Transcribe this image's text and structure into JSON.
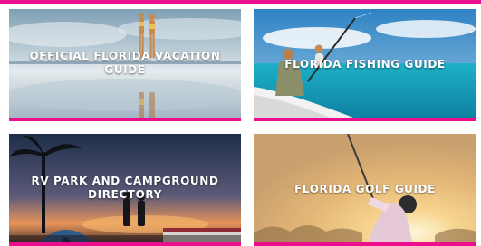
{
  "colors": {
    "accent": "#ec0e8d",
    "background": "#ffffff",
    "label_text": "#ffffff"
  },
  "guides": [
    {
      "title": "OFFICIAL FLORIDA VACATION GUIDE",
      "image": "beach-couple-photo"
    },
    {
      "title": "FLORIDA FISHING GUIDE",
      "image": "boat-fishing-photo"
    },
    {
      "title": "RV PARK AND CAMPGROUND DIRECTORY",
      "image": "sunset-campground-photo"
    },
    {
      "title": "FLORIDA GOLF GUIDE",
      "image": "golfer-sunset-photo"
    }
  ]
}
